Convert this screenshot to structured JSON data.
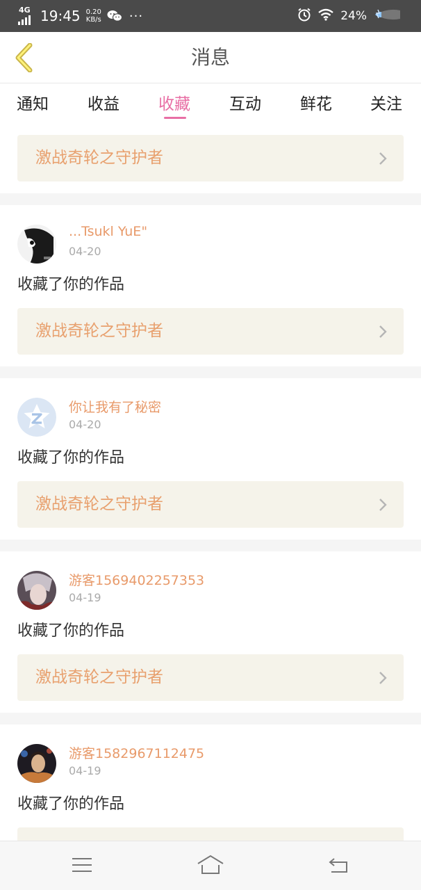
{
  "status_bar": {
    "network": "4G",
    "time": "19:45",
    "speed_value": "0.20",
    "speed_unit": "KB/s",
    "battery": "24%",
    "icons": [
      "signal-icon",
      "wechat-icon",
      "more-dots-icon",
      "alarm-icon",
      "wifi-icon",
      "battery-icon"
    ]
  },
  "header": {
    "title": "消息",
    "back_icon": "back-arrow-icon"
  },
  "tabs": [
    {
      "label": "通知",
      "active": false
    },
    {
      "label": "收益",
      "active": false
    },
    {
      "label": "收藏",
      "active": true
    },
    {
      "label": "互动",
      "active": false
    },
    {
      "label": "鲜花",
      "active": false
    },
    {
      "label": "关注",
      "active": false
    }
  ],
  "colors": {
    "accent_pink": "#e86fa5",
    "name_orange": "#e89a6a",
    "work_orange": "#e8a06e",
    "work_bg": "#f5f3ea",
    "status_bar_bg": "#4a4a4a"
  },
  "messages": [
    {
      "work_title": "激战奇轮之守护者"
    },
    {
      "user": "...Tsukl YuE\"",
      "date": "04-20",
      "action": "收藏了你的作品",
      "work_title": "激战奇轮之守护者"
    },
    {
      "user": "你让我有了秘密",
      "date": "04-20",
      "action": "收藏了你的作品",
      "work_title": "激战奇轮之守护者"
    },
    {
      "user": "游客1569402257353",
      "date": "04-19",
      "action": "收藏了你的作品",
      "work_title": "激战奇轮之守护者"
    },
    {
      "user": "游客1582967112475",
      "date": "04-19",
      "action": "收藏了你的作品",
      "work_title": ""
    }
  ],
  "nav_bar": {
    "icons": [
      "menu-icon",
      "home-icon",
      "back-icon"
    ]
  }
}
